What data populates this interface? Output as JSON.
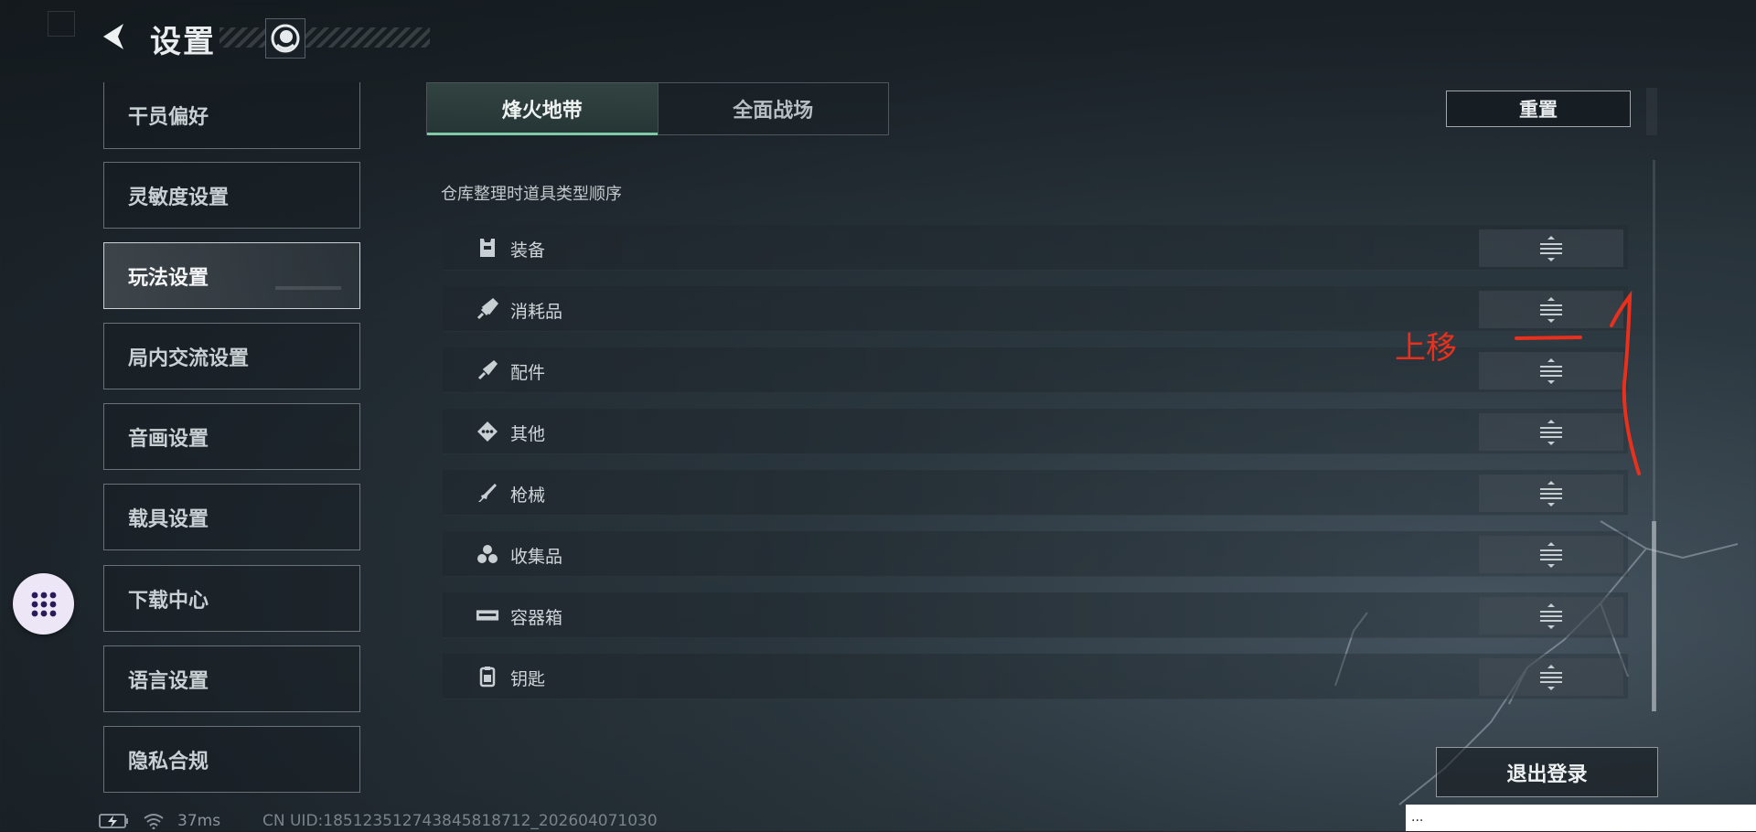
{
  "header": {
    "title": "设置"
  },
  "sidebar": {
    "items": [
      {
        "label": "干员偏好"
      },
      {
        "label": "灵敏度设置"
      },
      {
        "label": "玩法设置"
      },
      {
        "label": "局内交流设置"
      },
      {
        "label": "音画设置"
      },
      {
        "label": "载具设置"
      },
      {
        "label": "下载中心"
      },
      {
        "label": "语言设置"
      },
      {
        "label": "隐私合规"
      }
    ],
    "active_index": 2
  },
  "tabs": [
    {
      "label": "烽火地带",
      "active": true
    },
    {
      "label": "全面战场",
      "active": false
    }
  ],
  "reset_label": "重置",
  "section_label": "仓库整理时道具类型顺序",
  "items": [
    {
      "label": "装备",
      "icon": "armor-vest-icon"
    },
    {
      "label": "消耗品",
      "icon": "syringe-icon"
    },
    {
      "label": "配件",
      "icon": "attachment-icon"
    },
    {
      "label": "其他",
      "icon": "diamond-dots-icon"
    },
    {
      "label": "枪械",
      "icon": "rifle-icon"
    },
    {
      "label": "收集品",
      "icon": "collectibles-icon"
    },
    {
      "label": "容器箱",
      "icon": "container-box-icon"
    },
    {
      "label": "钥匙",
      "icon": "keycard-icon"
    }
  ],
  "logout_label": "退出登录",
  "annotation": {
    "text": "上移",
    "color": "#e8301c"
  },
  "status": {
    "ping": "37ms",
    "uid": "CN UID:18512351274384581871​2_202604071030"
  },
  "bottom_overlay": "..."
}
